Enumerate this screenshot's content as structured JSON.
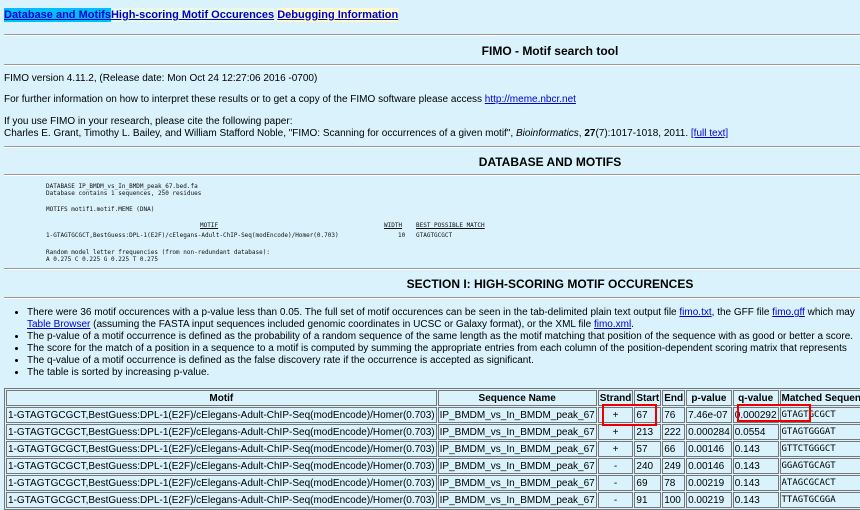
{
  "nav": {
    "db_link": "Database and Motifs",
    "motif_link": "High-scoring Motif Occurences",
    "debug_link": "Debugging Information"
  },
  "title": "FIMO - Motif search tool",
  "version_line": "FIMO version 4.11.2, (Release date: Mon Oct 24 12:27:06 2016 -0700)",
  "info_line_prefix": "For further information on how to interpret these results or to get a copy of the FIMO software please access",
  "info_link": "http://meme.nbcr.net",
  "cite_intro": "If you use FIMO in your research, please cite the following paper:",
  "cite_authors": "Charles E. Grant, Timothy L. Bailey, and William Stafford Noble, \"FIMO: Scanning for occurrences of a given motif\",",
  "cite_journal": "Bioinformatics",
  "cite_volume": "27",
  "cite_pages": "(7):1017-1018, 2011.",
  "cite_link": "[full text]",
  "db_section": {
    "heading": "DATABASE AND MOTIFS",
    "database_line": "DATABASE IP_BMDM_vs_In_BMDM_peak_67.bed.fa",
    "database_info": "Database contains 1 sequences, 250 residues",
    "motifs_line": "MOTIFS motif1.motif.MEME (DNA)",
    "col_motif": "MOTIF",
    "col_width": "WIDTH",
    "col_best": "BEST POSSIBLE MATCH",
    "motif_name": "1-GTAGTGCGCT,BestGuess:DPL-1(E2F)/cElegans-Adult-ChIP-Seq(modEncode)/Homer(0.703)",
    "motif_width": "10",
    "motif_best": "GTAGTGCGCT",
    "bg_line1": "Random model letter frequencies (from non-redundant database):",
    "bg_line2": "A 0.275 C 0.225 G 0.225 T 0.275"
  },
  "section1": {
    "heading": "SECTION I: HIGH-SCORING MOTIF OCCURENCES",
    "b1_part1": "There were 36 motif occurences with a p-value less than 0.05. The full set of motif occurences can be seen in the tab-delimited plain text output file",
    "b1_link1": "fimo.txt",
    "b1_part2": ", the GFF file",
    "b1_link2": "fimo.gff",
    "b1_part3": "which may",
    "b1_link3": "Table Browser",
    "b1_part4": "(assuming the FASTA input sequences included genomic coordinates in UCSC or Galaxy format), or the XML file",
    "b1_link4": "fimo.xml",
    "b1_end": ".",
    "b2": "The p-value of a motif occurrence is defined as the probability of a random sequence of the same length as the motif matching that position of the sequence with as good or better a score.",
    "b3": "The score for the match of a position in a sequence to a motif is computed by summing the appropriate entries from each column of the position-dependent scoring matrix that represents",
    "b4": "The q-value of a motif occurrence is defined as the false discovery rate if the occurrence is accepted as significant.",
    "b5": "The table is sorted by increasing p-value."
  },
  "table": {
    "headers": [
      "Motif",
      "Sequence Name",
      "Strand",
      "Start",
      "End",
      "p-value",
      "q-value",
      "Matched Sequence"
    ],
    "rows": [
      [
        "1-GTAGTGCGCT,BestGuess:DPL-1(E2F)/cElegans-Adult-ChIP-Seq(modEncode)/Homer(0.703)",
        "IP_BMDM_vs_In_BMDM_peak_67",
        "+",
        "67",
        "76",
        "7.46e-07",
        "0.000292",
        "GTAGTGCGCT"
      ],
      [
        "1-GTAGTGCGCT,BestGuess:DPL-1(E2F)/cElegans-Adult-ChIP-Seq(modEncode)/Homer(0.703)",
        "IP_BMDM_vs_In_BMDM_peak_67",
        "+",
        "213",
        "222",
        "0.000284",
        "0.0554",
        "GTAGTGGGAT"
      ],
      [
        "1-GTAGTGCGCT,BestGuess:DPL-1(E2F)/cElegans-Adult-ChIP-Seq(modEncode)/Homer(0.703)",
        "IP_BMDM_vs_In_BMDM_peak_67",
        "+",
        "57",
        "66",
        "0.00146",
        "0.143",
        "GTTCTGGGCT"
      ],
      [
        "1-GTAGTGCGCT,BestGuess:DPL-1(E2F)/cElegans-Adult-ChIP-Seq(modEncode)/Homer(0.703)",
        "IP_BMDM_vs_In_BMDM_peak_67",
        "-",
        "240",
        "249",
        "0.00146",
        "0.143",
        "GGAGTGCAGT"
      ],
      [
        "1-GTAGTGCGCT,BestGuess:DPL-1(E2F)/cElegans-Adult-ChIP-Seq(modEncode)/Homer(0.703)",
        "IP_BMDM_vs_In_BMDM_peak_67",
        "-",
        "69",
        "78",
        "0.00219",
        "0.143",
        "ATAGCGCACT"
      ],
      [
        "1-GTAGTGCGCT,BestGuess:DPL-1(E2F)/cElegans-Adult-ChIP-Seq(modEncode)/Homer(0.703)",
        "IP_BMDM_vs_In_BMDM_peak_67",
        "-",
        "91",
        "100",
        "0.00219",
        "0.143",
        "TTAGTGCGGA"
      ]
    ]
  },
  "colors": {
    "background": "#d9f2fb",
    "link": "#0000cc",
    "highlight": "#ee0000",
    "nav_active": "#00bfff"
  }
}
